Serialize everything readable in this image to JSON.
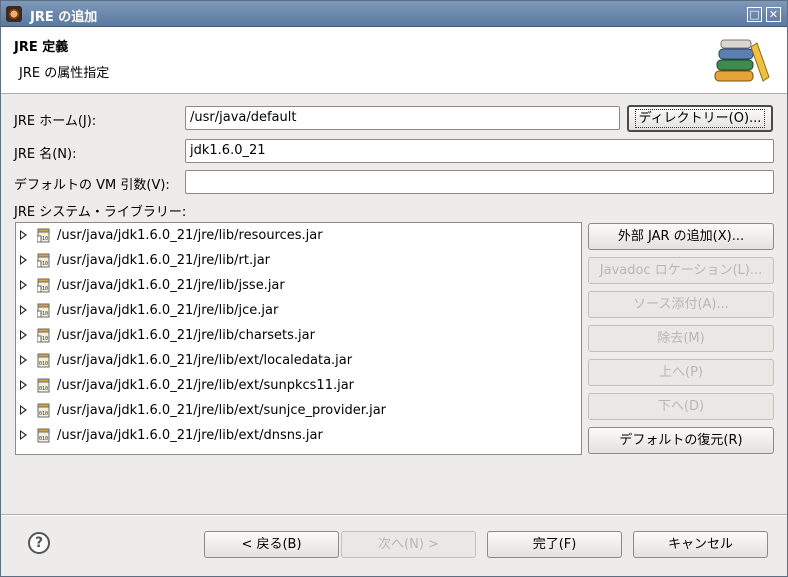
{
  "window": {
    "title": "JRE の追加",
    "maximize_glyph": "□",
    "close_glyph": "✕"
  },
  "banner": {
    "heading": "JRE 定義",
    "description": "JRE の属性指定",
    "icon": "books-icon"
  },
  "form": {
    "home_label": "JRE ホーム(J):",
    "home_value": "/usr/java/default",
    "directory_button": "ディレクトリー(O)...",
    "name_label": "JRE 名(N):",
    "name_value": "jdk1.6.0_21",
    "vmargs_label": "デフォルトの  VM 引数(V):",
    "vmargs_value": "",
    "libraries_label": "JRE システム・ライブラリー:"
  },
  "libraries": [
    {
      "path": "/usr/java/jdk1.6.0_21/jre/lib/resources.jar",
      "icon": "jar-src-icon"
    },
    {
      "path": "/usr/java/jdk1.6.0_21/jre/lib/rt.jar",
      "icon": "jar-src-icon"
    },
    {
      "path": "/usr/java/jdk1.6.0_21/jre/lib/jsse.jar",
      "icon": "jar-src-icon"
    },
    {
      "path": "/usr/java/jdk1.6.0_21/jre/lib/jce.jar",
      "icon": "jar-src-icon"
    },
    {
      "path": "/usr/java/jdk1.6.0_21/jre/lib/charsets.jar",
      "icon": "jar-src-icon"
    },
    {
      "path": "/usr/java/jdk1.6.0_21/jre/lib/ext/localedata.jar",
      "icon": "jar-icon"
    },
    {
      "path": "/usr/java/jdk1.6.0_21/jre/lib/ext/sunpkcs11.jar",
      "icon": "jar-icon"
    },
    {
      "path": "/usr/java/jdk1.6.0_21/jre/lib/ext/sunjce_provider.jar",
      "icon": "jar-icon"
    },
    {
      "path": "/usr/java/jdk1.6.0_21/jre/lib/ext/dnsns.jar",
      "icon": "jar-icon"
    }
  ],
  "side_buttons": {
    "add_external_jar": "外部 JAR の追加(X)...",
    "javadoc_location": "Javadoc ロケーション(L)...",
    "source_attachment": "ソース添付(A)...",
    "remove": "除去(M)",
    "up": "上へ(P)",
    "down": "下へ(D)",
    "restore_default": "デフォルトの復元(R)"
  },
  "footer": {
    "help": "?",
    "back": "< 戻る(B)",
    "next": "次へ(N) >",
    "finish": "完了(F)",
    "cancel": "キャンセル"
  }
}
